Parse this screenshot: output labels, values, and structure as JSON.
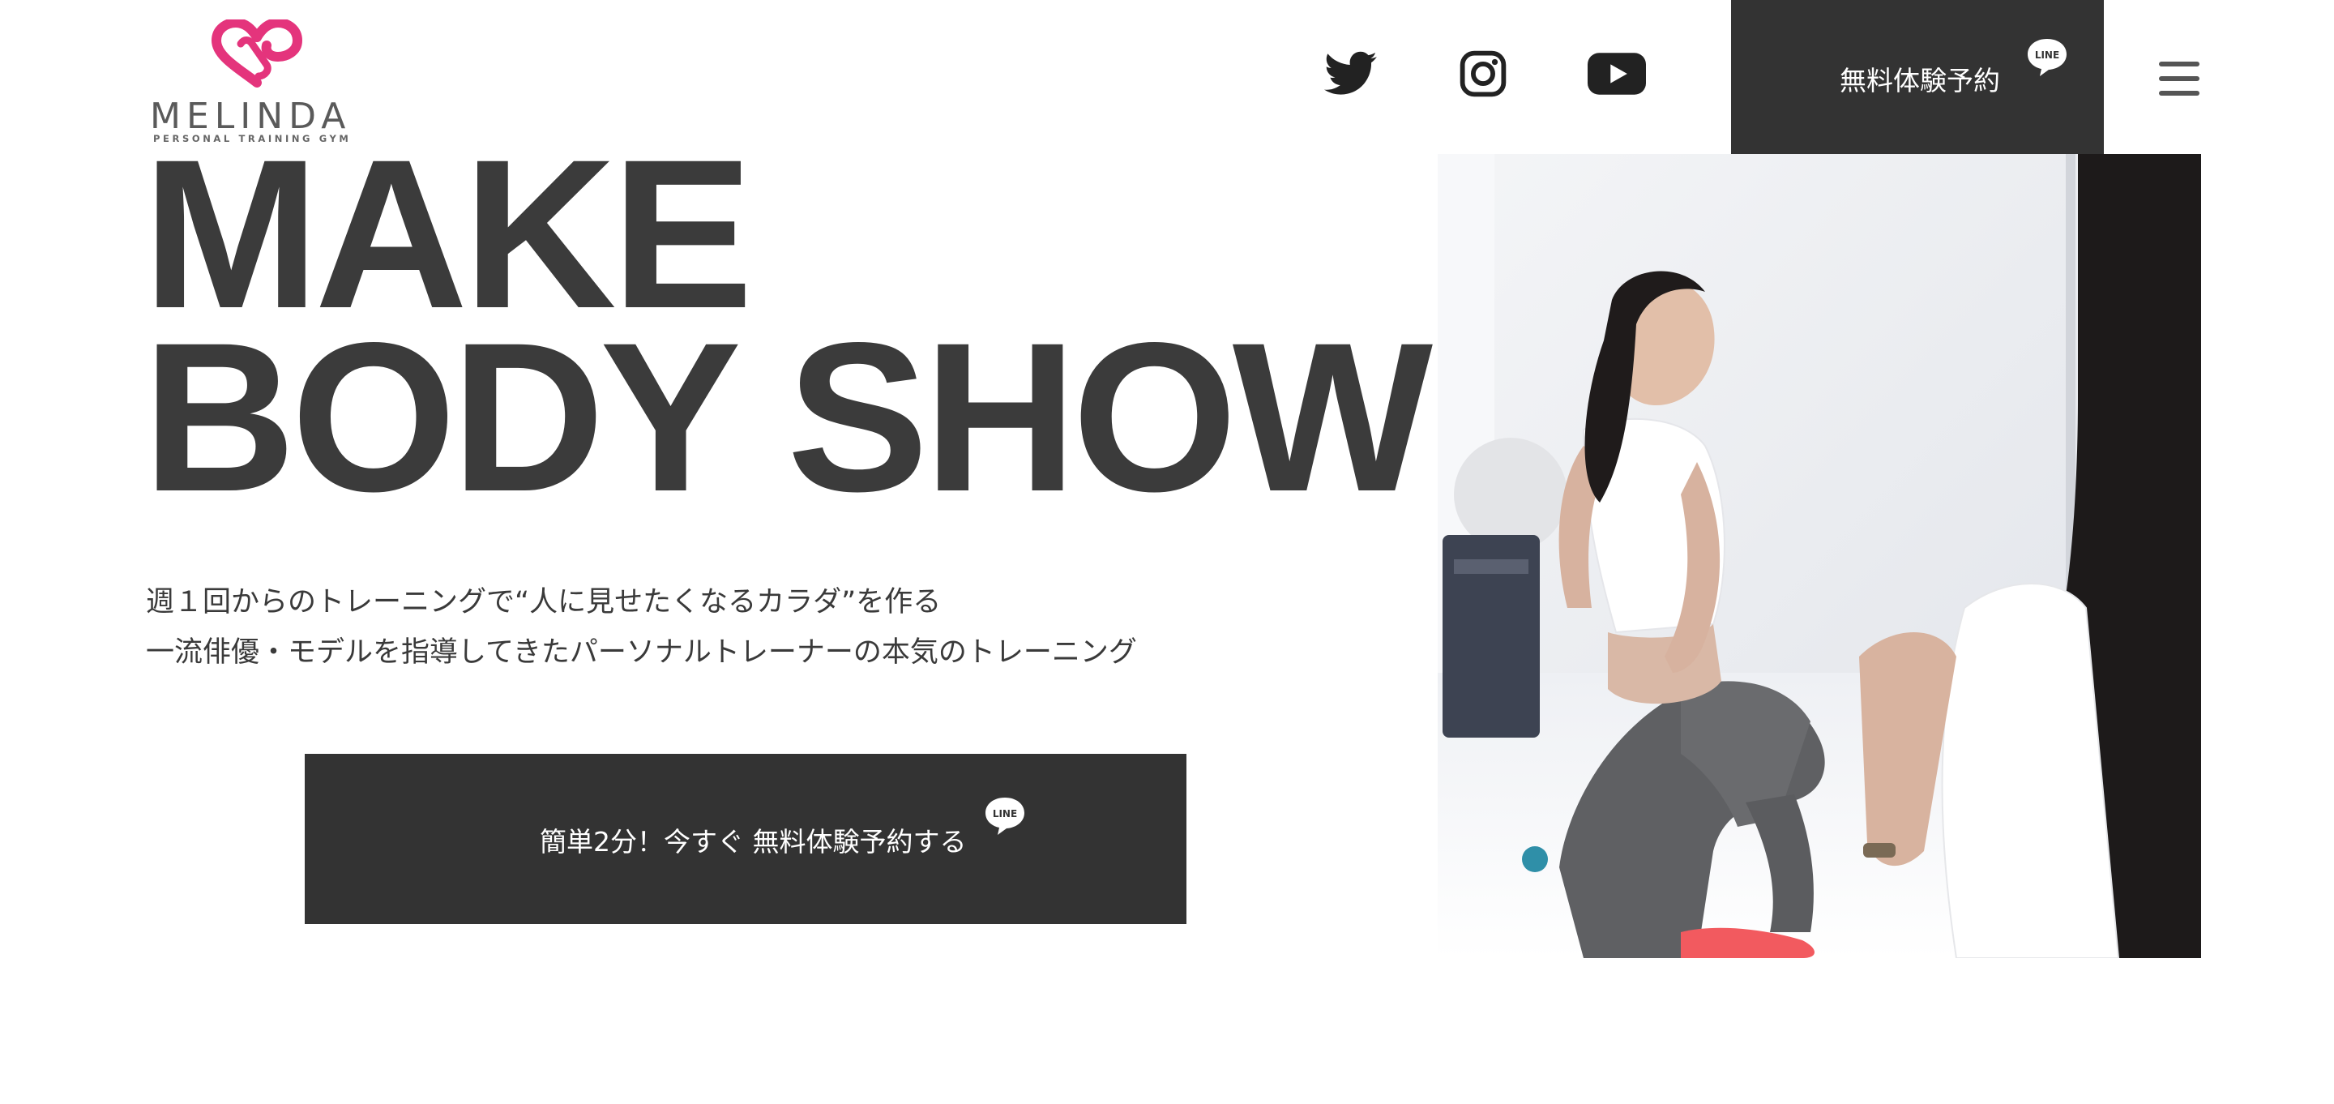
{
  "brand": {
    "name": "MELINDA",
    "tagline": "PERSONAL TRAINING GYM",
    "accent_color": "#e4347c"
  },
  "header": {
    "social": [
      {
        "icon": "twitter-icon"
      },
      {
        "icon": "instagram-icon"
      },
      {
        "icon": "youtube-icon"
      }
    ],
    "cta_label": "無料体験予約",
    "cta_badge": "LINE",
    "menu_icon": "hamburger-menu-icon"
  },
  "hero": {
    "title_line1": "MAKE",
    "title_line2": "BODY SHOW",
    "copy_line1": "週１回からのトレーニングで“人に見せたくなるカラダ”を作る",
    "copy_line2": "一流俳優・モデルを指導してきたパーソナルトレーナーの本気のトレーニング",
    "cta_label": "簡単2分！今すぐ 無料体験予約する",
    "cta_badge": "LINE"
  },
  "colors": {
    "dark": "#333333",
    "text": "#3a3a3a",
    "background": "#ffffff"
  }
}
